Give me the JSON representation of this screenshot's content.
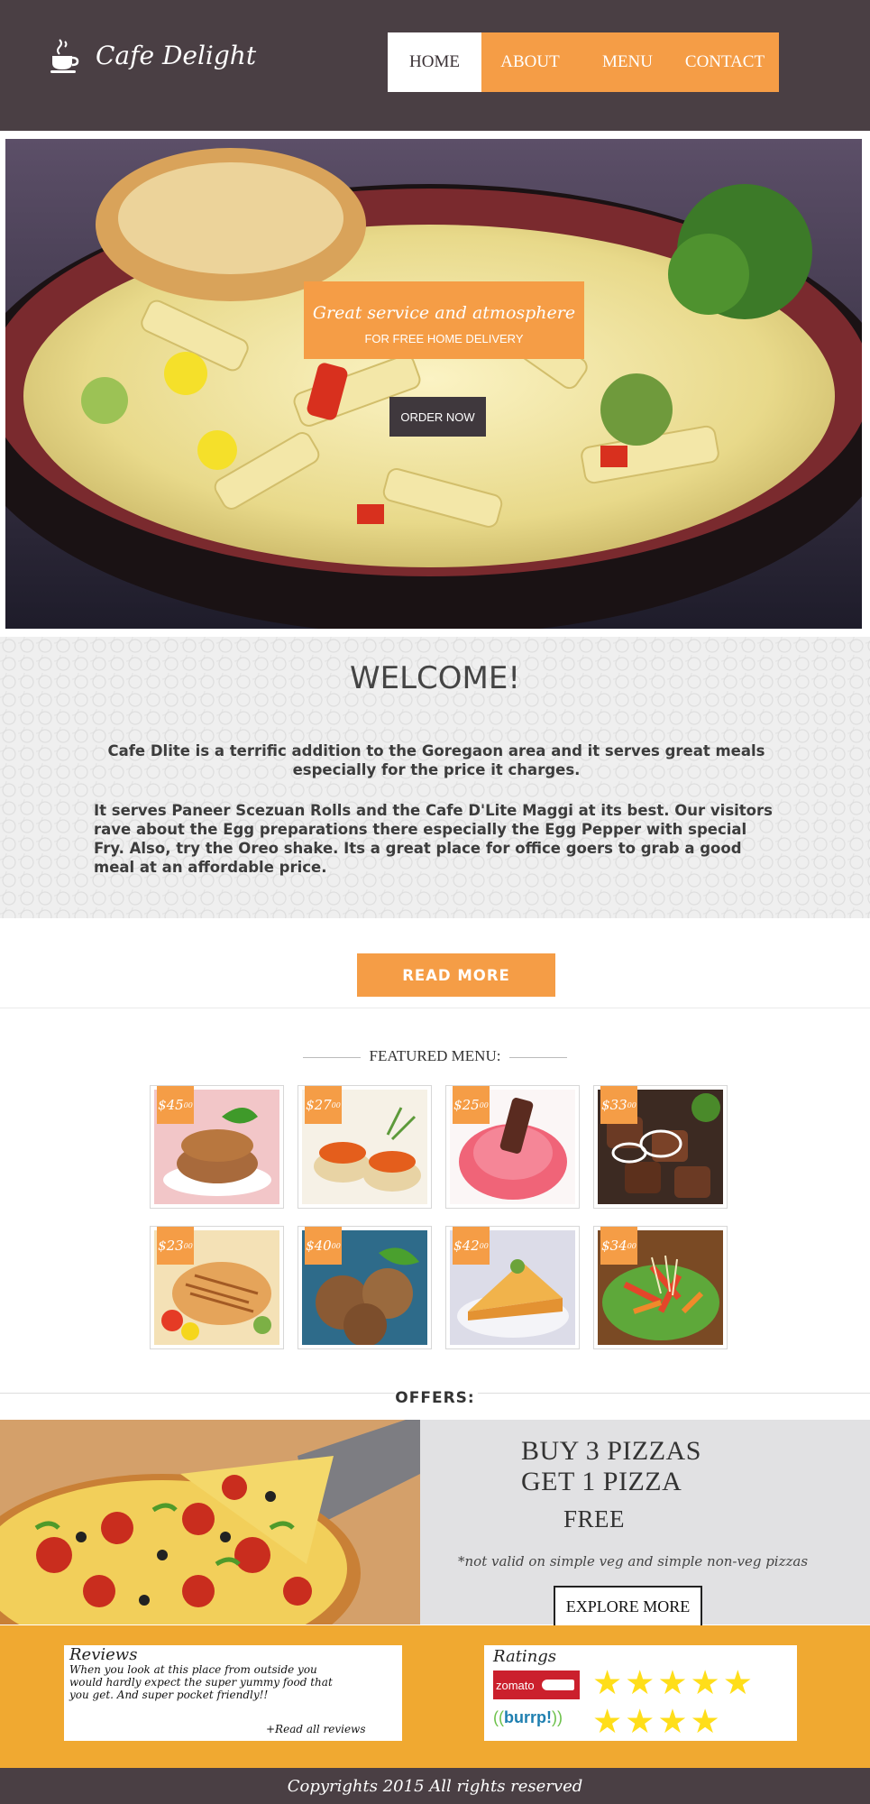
{
  "header": {
    "logo_text": "Cafe Delight",
    "logo_icon": "coffee-cup-icon",
    "nav": [
      {
        "label": "HOME",
        "active": true
      },
      {
        "label": "ABOUT",
        "active": false
      },
      {
        "label": "MENU",
        "active": false
      },
      {
        "label": "CONTACT",
        "active": false
      }
    ]
  },
  "hero": {
    "tagline": "Great service and atmosphere",
    "subtitle": "FOR FREE HOME DELIVERY",
    "cta": "ORDER NOW"
  },
  "welcome": {
    "title": "WELCOME!",
    "paragraph1": "Cafe Dlite is a terrific addition to the Goregaon area and it serves great meals especially for the price it charges.",
    "paragraph2": "It serves Paneer Scezuan Rolls and the Cafe D'Lite Maggi at its best. Our visitors rave about the Egg preparations there especially the Egg Pepper with special Fry. Also, try the Oreo shake. Its a great place for office goers to grab a good meal at an affordable price.",
    "read_more": "READ MORE"
  },
  "featured": {
    "title": "FEATURED MENU:",
    "items": [
      {
        "price": "$45",
        "cents": "00",
        "dish": "cutlets"
      },
      {
        "price": "$27",
        "cents": "00",
        "dish": "caviar-tarts"
      },
      {
        "price": "$25",
        "cents": "00",
        "dish": "strawberry-cupcake"
      },
      {
        "price": "$33",
        "cents": "00",
        "dish": "kebab"
      },
      {
        "price": "$23",
        "cents": "00",
        "dish": "grilled-chicken"
      },
      {
        "price": "$40",
        "cents": "00",
        "dish": "meatballs"
      },
      {
        "price": "$42",
        "cents": "00",
        "dish": "pie-slice"
      },
      {
        "price": "$34",
        "cents": "00",
        "dish": "salad"
      }
    ]
  },
  "offers": {
    "label": "OFFERS:",
    "line1": "BUY 3 PIZZAS",
    "line2": "GET 1 PIZZA",
    "line3": "FREE",
    "note": "*not valid on simple veg and simple non-veg pizzas",
    "button": "EXPLORE MORE"
  },
  "reviews": {
    "title": "Reviews",
    "text": "When you look at this place from outside you would hardly expect the super yummy food that you get. And super pocket friendly!!",
    "link": "+Read all reviews"
  },
  "ratings": {
    "title": "Ratings",
    "zomato_label": "zomato",
    "burrp_label": "burrp!",
    "zomato_stars": 5,
    "burrp_stars": 4,
    "star_color": "#ffde1a"
  },
  "footer": {
    "copyright": "Copyrights 2015 All rights reserved"
  },
  "colors": {
    "header_bg": "#4a3f44",
    "accent": "#f59d46",
    "band": "#f0a931"
  }
}
